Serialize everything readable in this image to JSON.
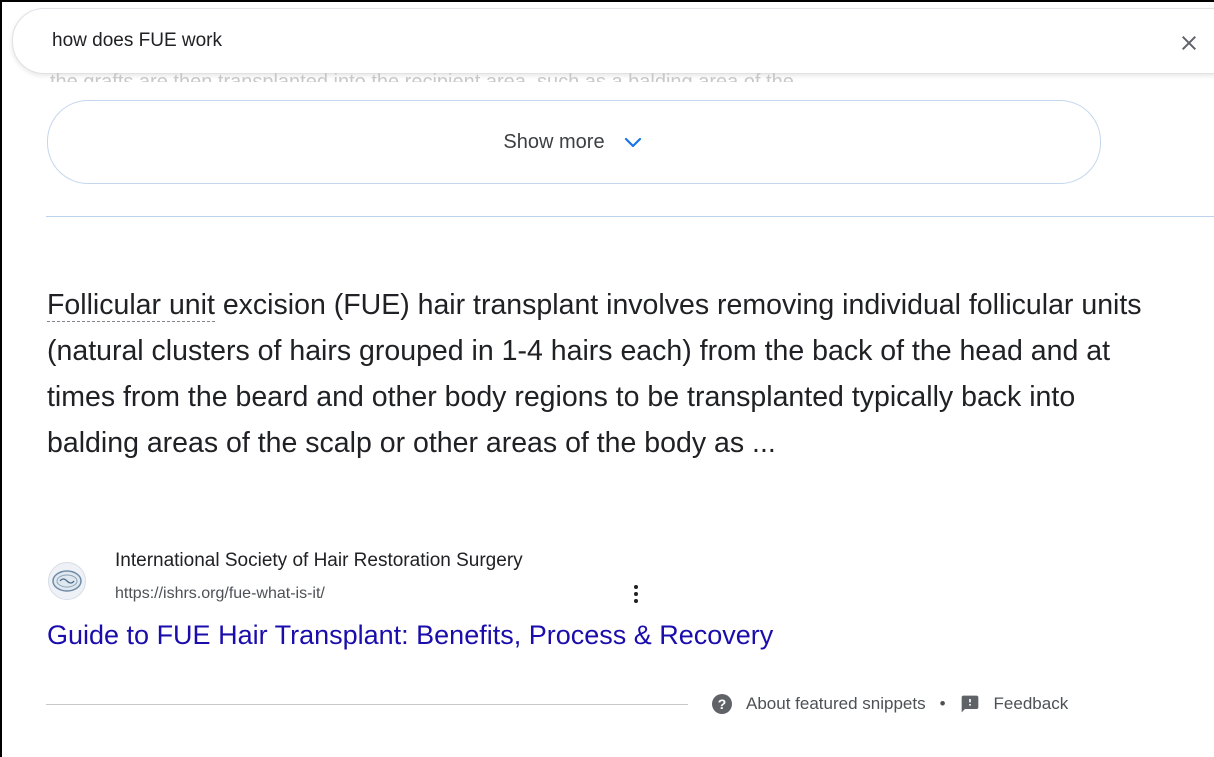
{
  "search": {
    "query": "how does FUE work"
  },
  "faded": {
    "text": "the grafts are then transplanted into the recipient area, such as a balding area of the"
  },
  "show_more": {
    "label": "Show more"
  },
  "snippet": {
    "term": "Follicular unit",
    "text": " excision (FUE) hair transplant involves removing individual follicular units (natural clusters of hairs grouped in 1-4 hairs each) from the back of the head and at times from the beard and other body regions to be transplanted typically back into balding areas of the scalp or other areas of the body as ..."
  },
  "source": {
    "name": "International Society of Hair Restoration Surgery",
    "url": "https://ishrs.org/fue-what-is-it/"
  },
  "result": {
    "title": "Guide to FUE Hair Transplant: Benefits, Process & Recovery"
  },
  "footer": {
    "about": "About featured snippets",
    "separator": "•",
    "feedback": "Feedback"
  },
  "colors": {
    "link": "#1a0dab",
    "accent": "#1a73e8",
    "text": "#202124"
  },
  "icons": [
    "close-icon",
    "chevron-down-icon",
    "more-vert-icon",
    "help-icon",
    "feedback-icon",
    "favicon"
  ]
}
